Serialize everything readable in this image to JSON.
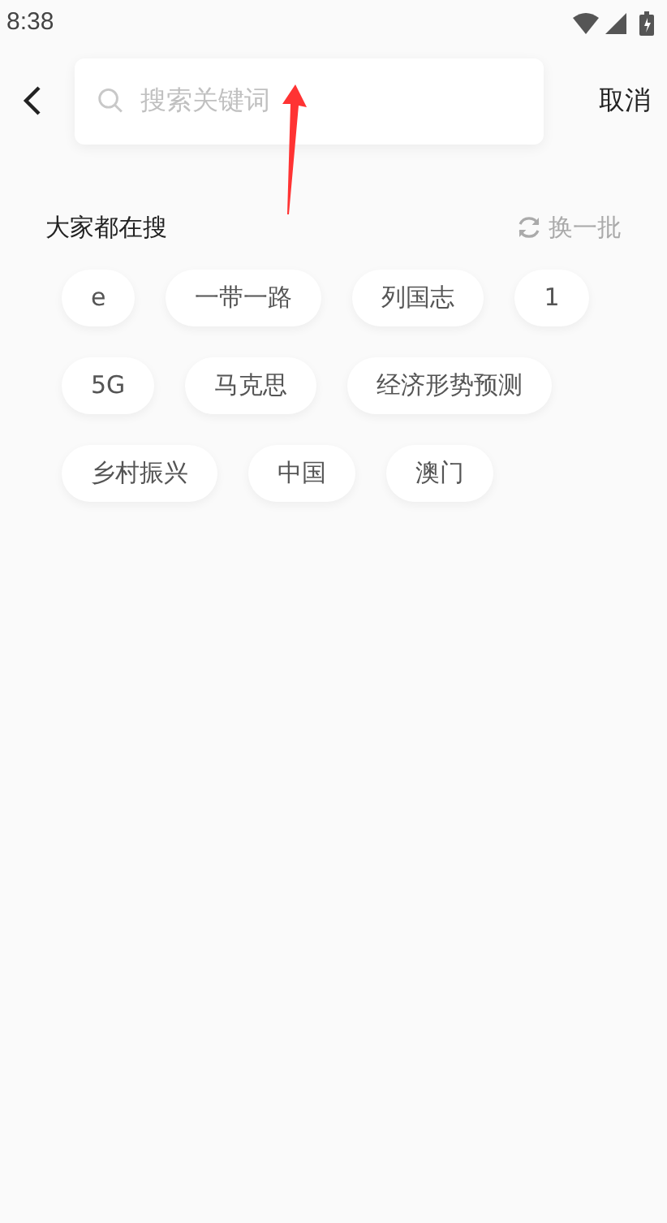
{
  "status_bar": {
    "time": "8:38"
  },
  "search": {
    "placeholder": "搜索关键词",
    "cancel": "取消"
  },
  "hot": {
    "title": "大家都在搜",
    "refresh": "换一批",
    "tags": [
      {
        "label": "e"
      },
      {
        "label": "一带一路"
      },
      {
        "label": "列国志"
      },
      {
        "label": "1"
      },
      {
        "label": "5G"
      },
      {
        "label": "马克思"
      },
      {
        "label": "经济形势预测"
      },
      {
        "label": "乡村振兴"
      },
      {
        "label": "中国"
      },
      {
        "label": "澳门"
      }
    ]
  }
}
